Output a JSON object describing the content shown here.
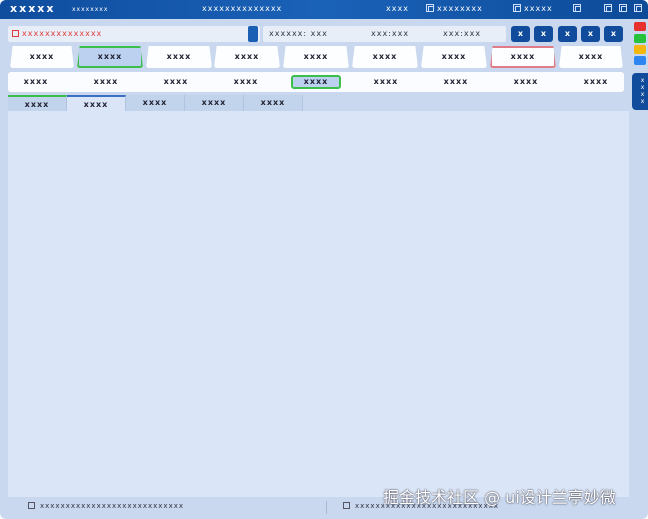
{
  "title": {
    "app": "xxxxx",
    "subtitle": "xxxxxxxx",
    "center": "xxxxxxxxxxxxxx",
    "item1": "xxxx",
    "item2": "xxxxxxxx",
    "item3": "xxxxx"
  },
  "toolbar": {
    "search_text": "xxxxxxxxxxxxxx",
    "field1": "xxxxxx: xxx",
    "field2": "xxx:xxx",
    "field3": "xxx:xxx",
    "buttons": [
      "x",
      "x",
      "x",
      "x",
      "x"
    ]
  },
  "swatches": [
    "#e8312f",
    "#27c23c",
    "#f4b70f",
    "#2f86f0"
  ],
  "tabs": [
    "xxxx",
    "xxxx",
    "xxxx",
    "xxxx",
    "xxxx",
    "xxxx",
    "xxxx",
    "xxxx",
    "xxxx"
  ],
  "bar_items": [
    "xxxx",
    "xxxx",
    "xxxx",
    "xxxx",
    "xxxx",
    "xxxx",
    "xxxx",
    "xxxx",
    "xxxx"
  ],
  "page_tabs": [
    "xxxx",
    "xxxx",
    "xxxx",
    "xxxx",
    "xxxx"
  ],
  "side_tab": "xxxx",
  "status": {
    "left": "xxxxxxxxxxxxxxxxxxxxxxxxxxxx",
    "right": "xxxxxxxxxxxxxxxxxxxxxxxxxxxx"
  },
  "watermark": "掘金技术社区 @ ui设计兰亭妙微"
}
